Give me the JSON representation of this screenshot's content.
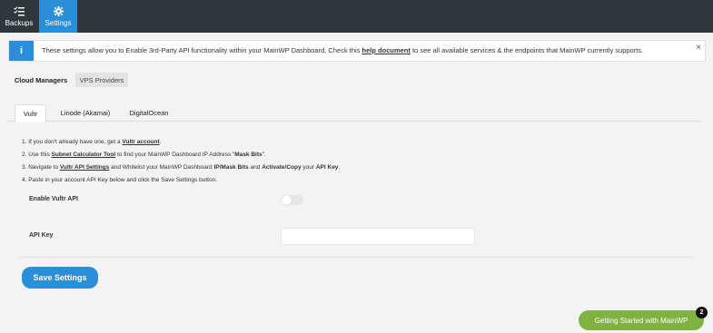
{
  "topnav": {
    "items": [
      {
        "label": "Backups",
        "icon": "backups-icon"
      },
      {
        "label": "Settings",
        "icon": "gear-icon",
        "active": true
      }
    ]
  },
  "notice": {
    "icon": "i",
    "text_before": "These settings allow you to Enable 3rd-Party API functionality within your MainWP Dashboard. Check this ",
    "link": "help document",
    "text_after": " to see all available services & the endpoints that MainWP currently supports.",
    "close": "×"
  },
  "subtabs": {
    "cloud": "Cloud Managers",
    "vps": "VPS Providers"
  },
  "tabs": {
    "vultr": "Vultr",
    "linode": "Linode (Akamai)",
    "digitalocean": "DigitalOcean"
  },
  "steps": {
    "s1_pre": "1. If you don't already have one, get a ",
    "s1_link": "Vultr account",
    "s1_post": ".",
    "s2_pre": "2. Use this ",
    "s2_link": "Subnet Calculator Tool",
    "s2_mid": " to find your MainWP Dashboard IP Address \"",
    "s2_bold": "Mask Bits",
    "s2_post": "\".",
    "s3_pre": "3. Navigate to ",
    "s3_link": "Vultr API Settings",
    "s3_mid1": " and Whitelist your MainWP Dashboard ",
    "s3_bold1": "IP/Mask Bits",
    "s3_mid2": " and ",
    "s3_bold2": "Activate/Copy",
    "s3_mid3": " your ",
    "s3_bold3": "API Key",
    "s3_post": ".",
    "s4": "4. Paste in your account API Key below and click the Save Settings button."
  },
  "form": {
    "enable_label": "Enable Vultr API",
    "enable_value": false,
    "api_key_label": "API Key",
    "api_key_value": "",
    "save_label": "Save Settings"
  },
  "getting_started": {
    "label": "Getting Started with MainWP",
    "badge": "2"
  },
  "colors": {
    "topbar": "#2f373d",
    "accent": "#2b8ed9",
    "green": "#7fb241"
  }
}
